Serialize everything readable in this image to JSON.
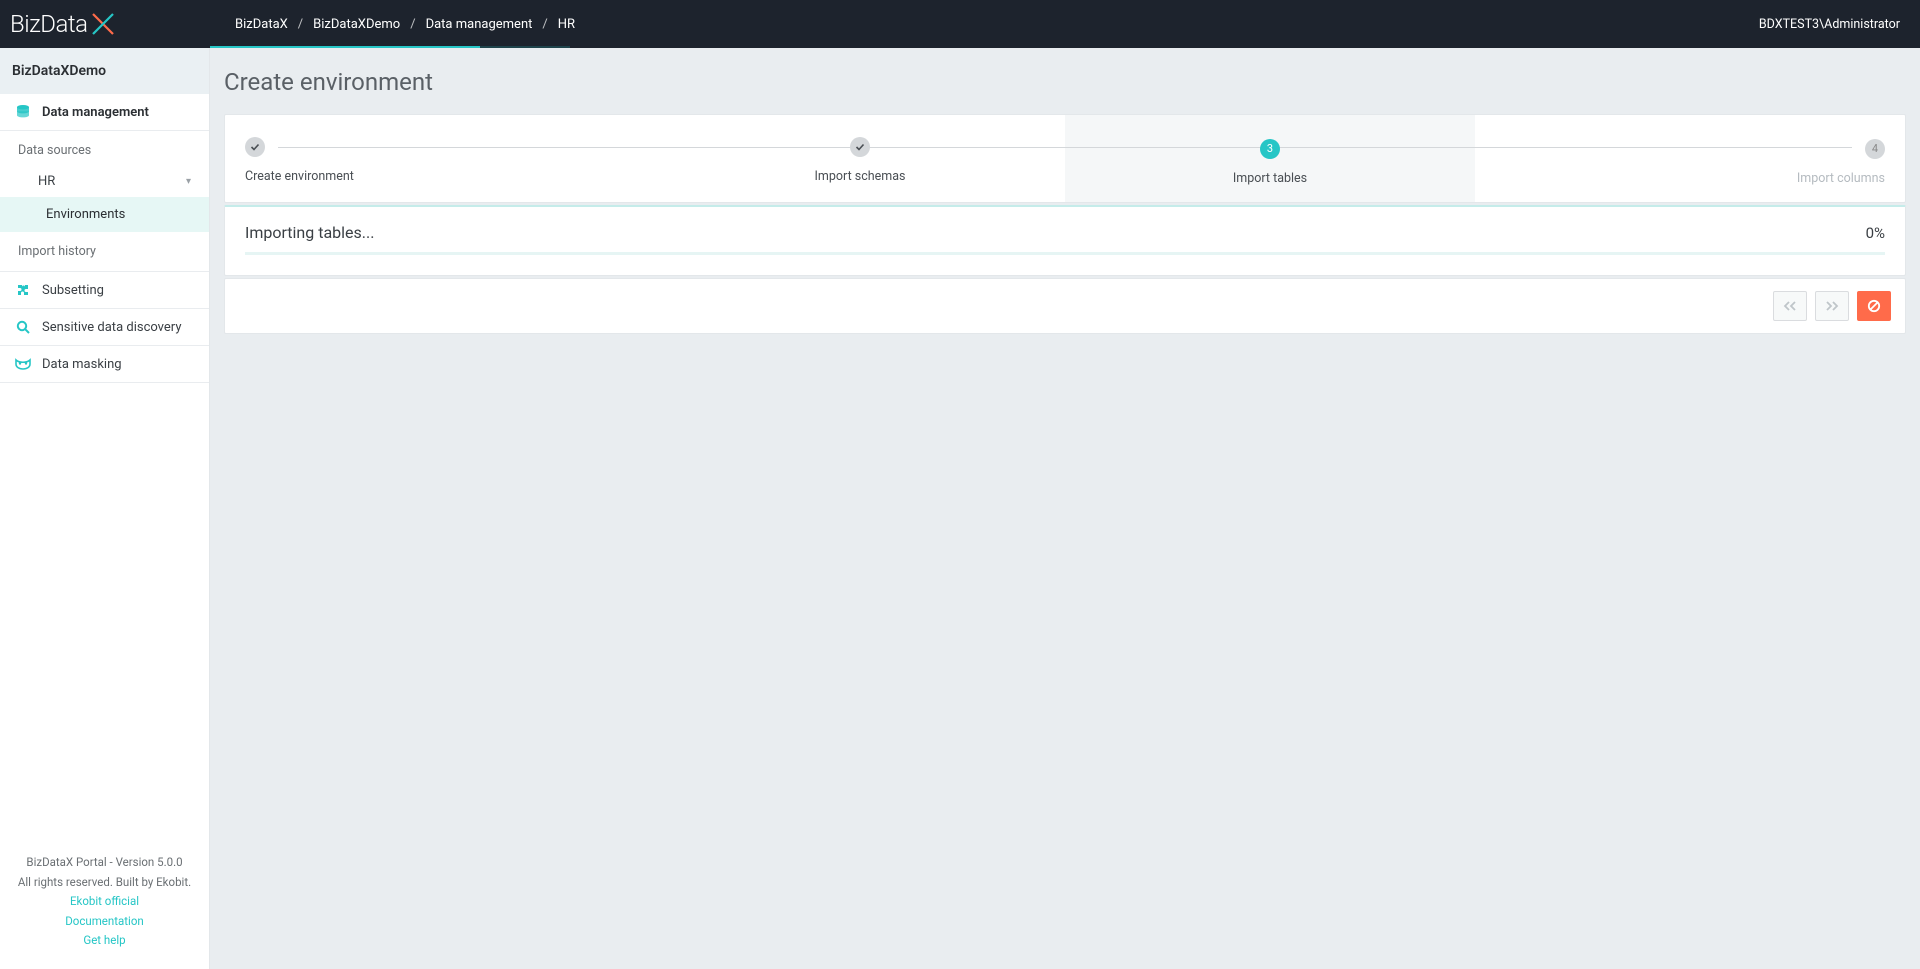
{
  "brand": "BizData",
  "breadcrumb": {
    "items": [
      "BizDataX",
      "BizDataXDemo",
      "Data management",
      "HR"
    ],
    "sep": "/"
  },
  "user": "BDXTEST3\\Administrator",
  "sidebar": {
    "project": "BizDataXDemo",
    "data_management": "Data management",
    "data_sources_label": "Data sources",
    "ds_item": "HR",
    "environments": "Environments",
    "import_history": "Import history",
    "subsetting": "Subsetting",
    "sensitive": "Sensitive data discovery",
    "masking": "Data masking"
  },
  "footer": {
    "line1": "BizDataX Portal - Version 5.0.0",
    "line2": "All rights reserved. Built by Ekobit.",
    "link1": "Ekobit official",
    "link2": "Documentation",
    "link3": "Get help"
  },
  "page": {
    "title": "Create environment",
    "steps": [
      {
        "label": "Create environment",
        "state": "done",
        "mark": "✓"
      },
      {
        "label": "Import schemas",
        "state": "done",
        "mark": "✓"
      },
      {
        "label": "Import tables",
        "state": "active",
        "mark": "3"
      },
      {
        "label": "Import columns",
        "state": "pending",
        "mark": "4"
      }
    ],
    "progress_text": "Importing tables...",
    "progress_pct": "0%"
  }
}
